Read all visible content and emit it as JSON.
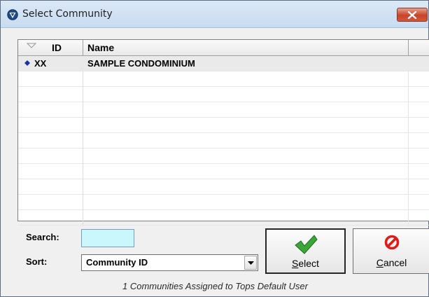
{
  "window": {
    "title": "Select Community"
  },
  "grid": {
    "columns": [
      "ID",
      "Name"
    ],
    "rows": [
      {
        "id": "XX",
        "name": "SAMPLE CONDOMINIUM",
        "selected": true
      }
    ]
  },
  "search": {
    "label": "Search:",
    "value": ""
  },
  "sort": {
    "label": "Sort:",
    "value": "Community ID"
  },
  "buttons": {
    "select": {
      "accel": "S",
      "rest": "elect"
    },
    "cancel": {
      "accel": "C",
      "rest": "ancel"
    }
  },
  "status_text": "1 Communities Assigned to Tops Default User",
  "colors": {
    "search_bg": "#c9f7fb",
    "select_icon": "#3aa63a",
    "cancel_icon": "#e01919",
    "row_marker": "#1a2fa8"
  },
  "icons": [
    "app-logo-icon",
    "close-icon",
    "sort-arrow-icon",
    "row-marker-icon",
    "dropdown-arrow-icon",
    "checkmark-icon",
    "no-entry-icon"
  ]
}
